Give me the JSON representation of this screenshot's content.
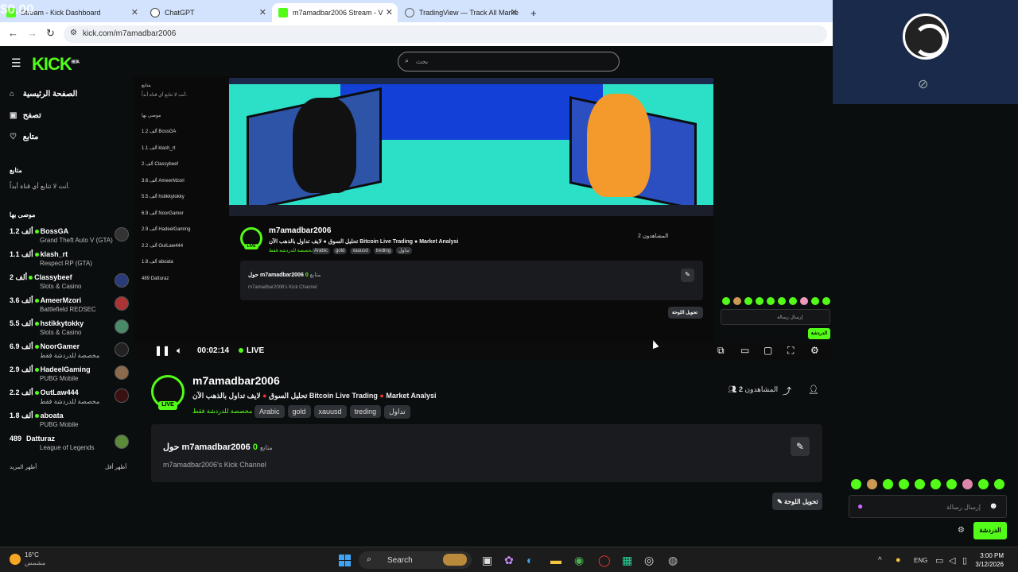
{
  "browser": {
    "tabs": [
      {
        "title": "Stream - Kick Dashboard",
        "icon": "kick-icon",
        "active": false
      },
      {
        "title": "ChatGPT",
        "icon": "chatgpt-icon",
        "active": false
      },
      {
        "title": "m7amadbar2006 Stream - V",
        "icon": "kick-icon",
        "active": true
      },
      {
        "title": "TradingView — Track All Marke",
        "icon": "tradingview-icon",
        "active": false
      }
    ],
    "new_tab_label": "+",
    "url": "kick.com/m7amadbar2006",
    "overlay_text_1": "$0.00",
    "overlay_text_2": "$0.00"
  },
  "sidebar": {
    "logo": "KICK",
    "logo_sup": "BETA",
    "nav": [
      {
        "label": "الصفحة الرئيسية",
        "icon": "home-icon"
      },
      {
        "label": "تصفح",
        "icon": "browse-icon"
      },
      {
        "label": "متابع",
        "icon": "heart-icon"
      }
    ],
    "following_title": "متابع",
    "following_empty": "أنت لا تتابع أي قناة أبداً.",
    "recommended_title": "موصى بها",
    "recommended": [
      {
        "count": "1.2 ألف",
        "name": "BossGA",
        "category": "Grand Theft Auto V (GTA)"
      },
      {
        "count": "1.1 ألف",
        "name": "klash_rt",
        "category": "Respect RP (GTA)"
      },
      {
        "count": "2 ألف",
        "name": "Classybeef",
        "category": "Slots & Casino"
      },
      {
        "count": "3.6 ألف",
        "name": "AmeerMzori",
        "category": "Battlefield REDSEC"
      },
      {
        "count": "5.5 ألف",
        "name": "hstikkytokky",
        "category": "Slots & Casino"
      },
      {
        "count": "6.9 ألف",
        "name": "NoorGamer",
        "category": "مخصصة للدردشة فقط"
      },
      {
        "count": "2.9 ألف",
        "name": "HadeelGaming",
        "category": "PUBG Mobile"
      },
      {
        "count": "2.2 ألف",
        "name": "OutLaw444",
        "category": "مخصصة للدردشة فقط"
      },
      {
        "count": "1.8 ألف",
        "name": "aboata",
        "category": "PUBG Mobile"
      },
      {
        "count": "489",
        "name": "Datturaz",
        "category": "League of Legends"
      }
    ],
    "show_more": "أظهر المزيد",
    "show_less": "أظهر أقل"
  },
  "search": {
    "placeholder": "بحث"
  },
  "channel": {
    "name": "m7amadbar2006",
    "live_label": "LIVE",
    "title_part1": "Market Analysi",
    "title_part2": "Bitcoin Live Trading",
    "title_part3": "لايف تداول بالذهب الآن",
    "title_part4": "تحليل السوق",
    "category": "مخصصة للدردشة فقط",
    "tags": [
      "Arabic",
      "gold",
      "xauusd",
      "treding",
      "تداول"
    ],
    "viewers_label": "المشاهدون",
    "viewers_count": "2",
    "about_title": "حول m7amadbar2006",
    "followers_count": "0",
    "followers_label": "متابع",
    "about_desc": "m7amadbar2006's Kick Channel",
    "dashboard_btn": "تحويل اللوحة"
  },
  "player": {
    "time": "00:02:14",
    "live": "LIVE"
  },
  "chat": {
    "placeholder": "إرسال رسالة",
    "send_label": "الدردشة"
  },
  "taskbar": {
    "temp": "16°C",
    "weather": "مشمس",
    "search_label": "Search",
    "lang": "ENG",
    "time": "3:00 PM",
    "date": "3/12/2026"
  },
  "colors": {
    "accent": "#53fc18",
    "bg": "#0b0e0f",
    "card": "#191b1f"
  }
}
